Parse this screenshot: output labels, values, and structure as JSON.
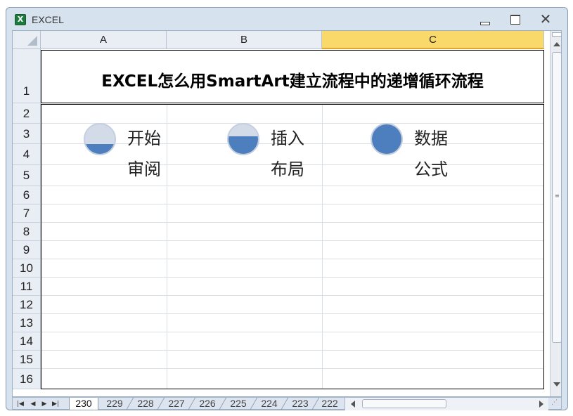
{
  "window": {
    "title": "EXCEL",
    "app_icon": "excel-icon"
  },
  "columns": [
    "A",
    "B",
    "C"
  ],
  "selected_column": "C",
  "rows": [
    "1",
    "2",
    "3",
    "4",
    "5",
    "6",
    "7",
    "8",
    "9",
    "10",
    "11",
    "12",
    "13",
    "14",
    "15",
    "16"
  ],
  "title_cell": "EXCEL怎么用SmartArt建立流程中的递增循环流程",
  "smartart": [
    {
      "line1": "开始",
      "line2": "审阅",
      "level": 0.33
    },
    {
      "line1": "插入",
      "line2": "布局",
      "level": 0.6
    },
    {
      "line1": "数据",
      "line2": "公式",
      "level": 1.0
    }
  ],
  "sheet_tabs": [
    "230",
    "229",
    "228",
    "227",
    "226",
    "225",
    "224",
    "223",
    "222"
  ],
  "active_tab": "230",
  "colors": {
    "accent_fill": "#4d7fbf",
    "circle_bg": "#d3dbe8",
    "selected_header": "#f8d96a"
  }
}
